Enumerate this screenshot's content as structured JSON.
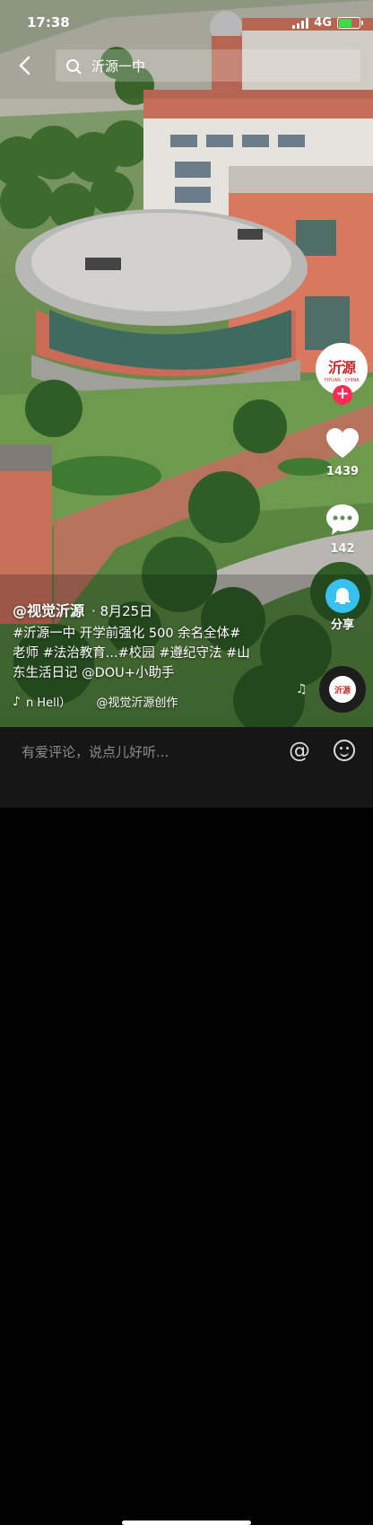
{
  "status_bar": {
    "time": "17:38",
    "network": "4G"
  },
  "search": {
    "query": "沂源一中"
  },
  "author": {
    "avatar_text": "沂源",
    "avatar_subtext": "YIYUAN · CHINA",
    "follow_label": "+"
  },
  "actions": {
    "likes": "1439",
    "comments": "142",
    "share_label": "分享"
  },
  "caption": {
    "author_handle": "@视觉沂源",
    "date": "· 8月25日",
    "line1": "#沂源一中 开学前强化 500 余名全体#",
    "line2": "老师 #法治教育...#校园 #遵纪守法 #山",
    "line3": "东生活日记 @DOU+小助手"
  },
  "music": {
    "title": "n Hell）",
    "credit": "@视觉沂源创作"
  },
  "comment_bar": {
    "placeholder": "有爱评论，说点儿好听..."
  },
  "colors": {
    "like_red": "#fe2c55",
    "share_blue": "#38c0f0",
    "brand_red": "#c62828"
  },
  "icons": [
    "back-icon",
    "search-icon",
    "signal-icon",
    "battery-icon",
    "heart-icon",
    "comment-icon",
    "share-icon",
    "music-note-icon",
    "at-icon",
    "emoji-icon"
  ]
}
